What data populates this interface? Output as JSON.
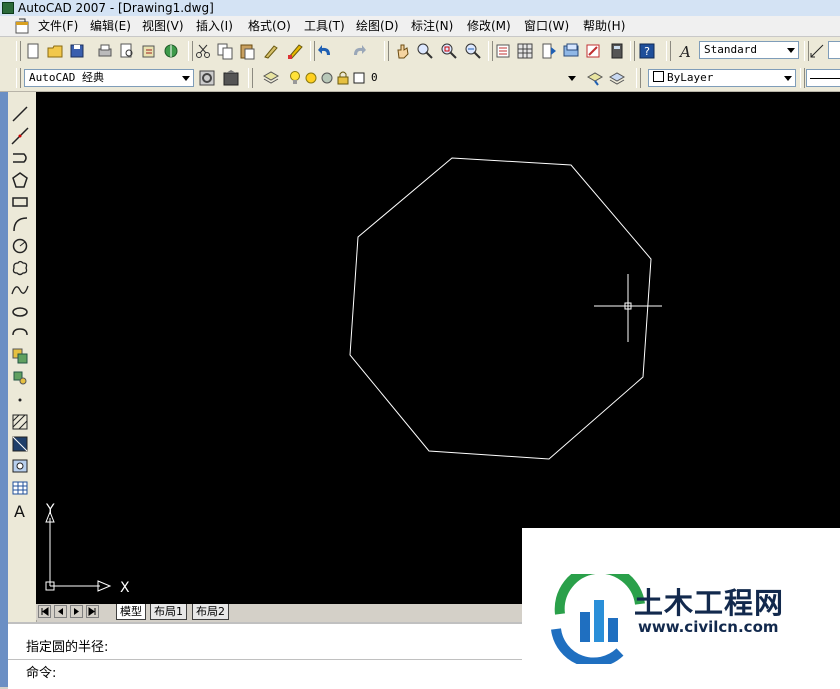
{
  "window": {
    "title": "AutoCAD 2007 - [Drawing1.dwg]"
  },
  "menu": [
    "文件(F)",
    "编辑(E)",
    "视图(V)",
    "插入(I)",
    "格式(O)",
    "工具(T)",
    "绘图(D)",
    "标注(N)",
    "修改(M)",
    "窗口(W)",
    "帮助(H)"
  ],
  "toolbar": {
    "text_style": "Standard",
    "workspace": "AutoCAD 经典",
    "layer": "0",
    "color": "ByLayer"
  },
  "tabs": {
    "model": "模型",
    "layout1": "布局1",
    "layout2": "布局2"
  },
  "ucs": {
    "x_label": "X",
    "y_label": "Y"
  },
  "command": {
    "history": "指定圆的半径:",
    "prompt": "命令:"
  },
  "watermark": {
    "name": "土木工程网",
    "url": "www.civilcn.com"
  },
  "icons": {
    "toolbar1": [
      "new-icon",
      "open-icon",
      "save-icon",
      "plot-icon",
      "plot-preview-icon",
      "publish-icon",
      "3d-dwf-icon",
      "cut-icon",
      "copy-icon",
      "paste-icon",
      "match-properties-icon",
      "block-editor-icon",
      "undo-icon",
      "redo-icon",
      "pan-icon",
      "zoom-realtime-icon",
      "zoom-window-icon",
      "zoom-previous-icon",
      "properties-icon",
      "design-center-icon",
      "tool-palettes-icon",
      "sheet-set-icon",
      "markup-icon",
      "quickcalc-icon",
      "help-icon",
      "text-style-icon",
      "dim-style-icon"
    ],
    "left_draw": [
      "line-icon",
      "construction-line-icon",
      "polyline-icon",
      "polygon-icon",
      "rectangle-icon",
      "arc-icon",
      "circle-icon",
      "revision-cloud-icon",
      "spline-icon",
      "ellipse-icon",
      "ellipse-arc-icon",
      "insert-block-icon",
      "make-block-icon",
      "point-icon",
      "hatch-icon",
      "gradient-icon",
      "region-icon",
      "table-icon",
      "multiline-text-icon"
    ]
  },
  "colors": {
    "canvas": "#000000",
    "geometry": "#ffffff",
    "accent": "#1f5fb3"
  }
}
